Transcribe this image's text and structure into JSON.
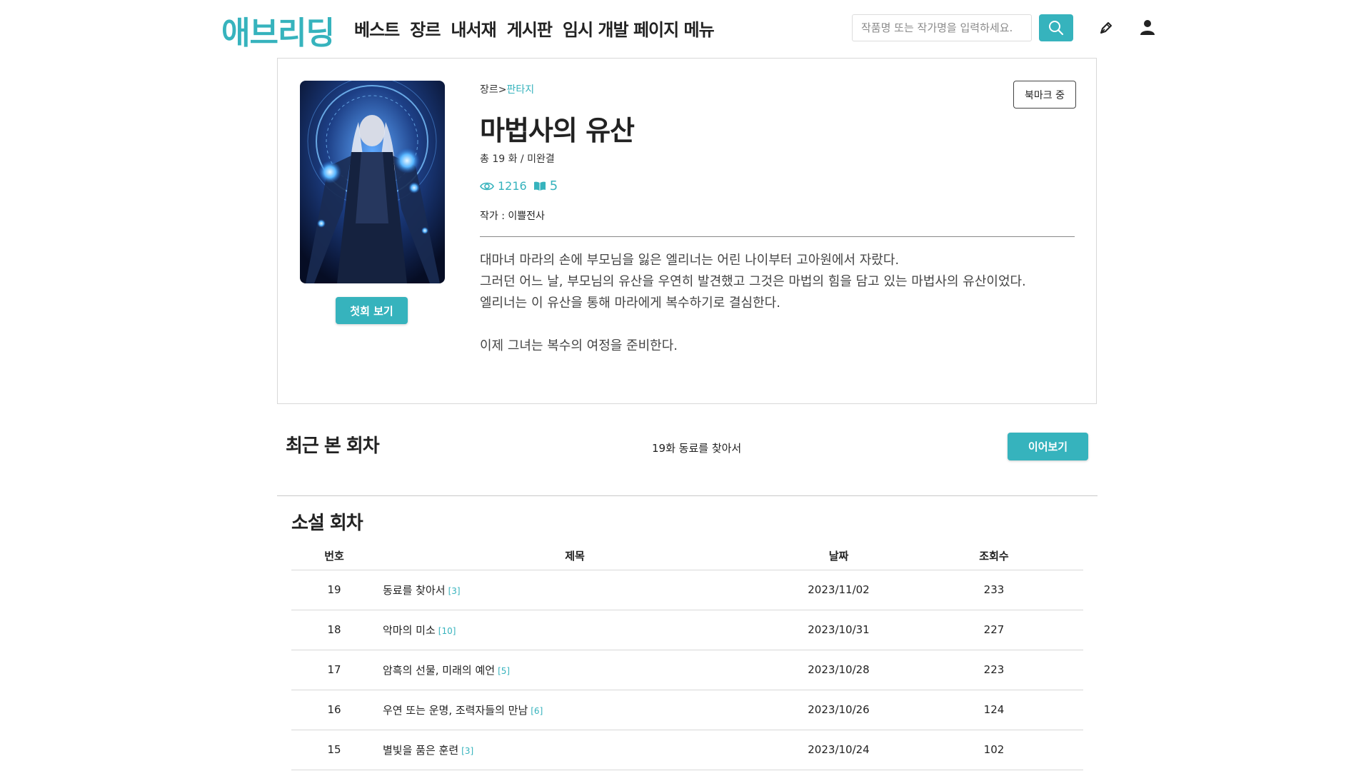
{
  "brand": {
    "logo": "애브리딩",
    "accent_color": "#36b3bd"
  },
  "header": {
    "nav": [
      {
        "label": "베스트"
      },
      {
        "label": "장르"
      },
      {
        "label": "내서재"
      },
      {
        "label": "게시판"
      },
      {
        "label": "임시 개발 페이지 메뉴"
      }
    ],
    "search": {
      "placeholder": "작품명 또는 작가명을 입력하세요.",
      "value": "",
      "icon": "search-icon"
    },
    "write_icon": "pen-icon",
    "user_icon": "user-icon"
  },
  "novel": {
    "genre_label": "장르>",
    "genre": "판타지",
    "title": "마법사의 유산",
    "episode_info": "총 19 화 / 미완결",
    "views": "1216",
    "views_icon": "eye-icon",
    "bookmarks": "5",
    "bookmarks_icon": "book-icon",
    "author": "작가 : 이쁠전사",
    "description": [
      "대마녀 마라의 손에 부모님을 잃은 엘리너는 어린 나이부터 고아원에서 자랐다.",
      "그러던 어느 날, 부모님의 유산을 우연히 발견했고 그것은 마법의 힘을 담고 있는 마법사의 유산이었다.",
      "엘리너는 이 유산을 통해 마라에게 복수하기로 결심한다.",
      " ",
      "이제 그녀는 복수의 여정을 준비한다."
    ],
    "first_button": "첫회 보기",
    "bookmark_button": "북마크 중"
  },
  "recent": {
    "title": "최근 본 회차",
    "episode": "19화 동료를 찾아서",
    "continue_button": "이어보기"
  },
  "episodes": {
    "title": "소설 회차",
    "columns": [
      "번호",
      "제목",
      "날짜",
      "조회수"
    ],
    "rows": [
      {
        "num": "19",
        "title": "동료를 찾아서",
        "comments": "[3]",
        "date": "2023/11/02",
        "views": "233"
      },
      {
        "num": "18",
        "title": "악마의 미소",
        "comments": "[10]",
        "date": "2023/10/31",
        "views": "227"
      },
      {
        "num": "17",
        "title": "암흑의 선물, 미래의 예언",
        "comments": "[5]",
        "date": "2023/10/28",
        "views": "223"
      },
      {
        "num": "16",
        "title": "우연 또는 운명, 조력자들의 만남",
        "comments": "[6]",
        "date": "2023/10/26",
        "views": "124"
      },
      {
        "num": "15",
        "title": "별빛을 품은 훈련",
        "comments": "[3]",
        "date": "2023/10/24",
        "views": "102"
      }
    ]
  }
}
